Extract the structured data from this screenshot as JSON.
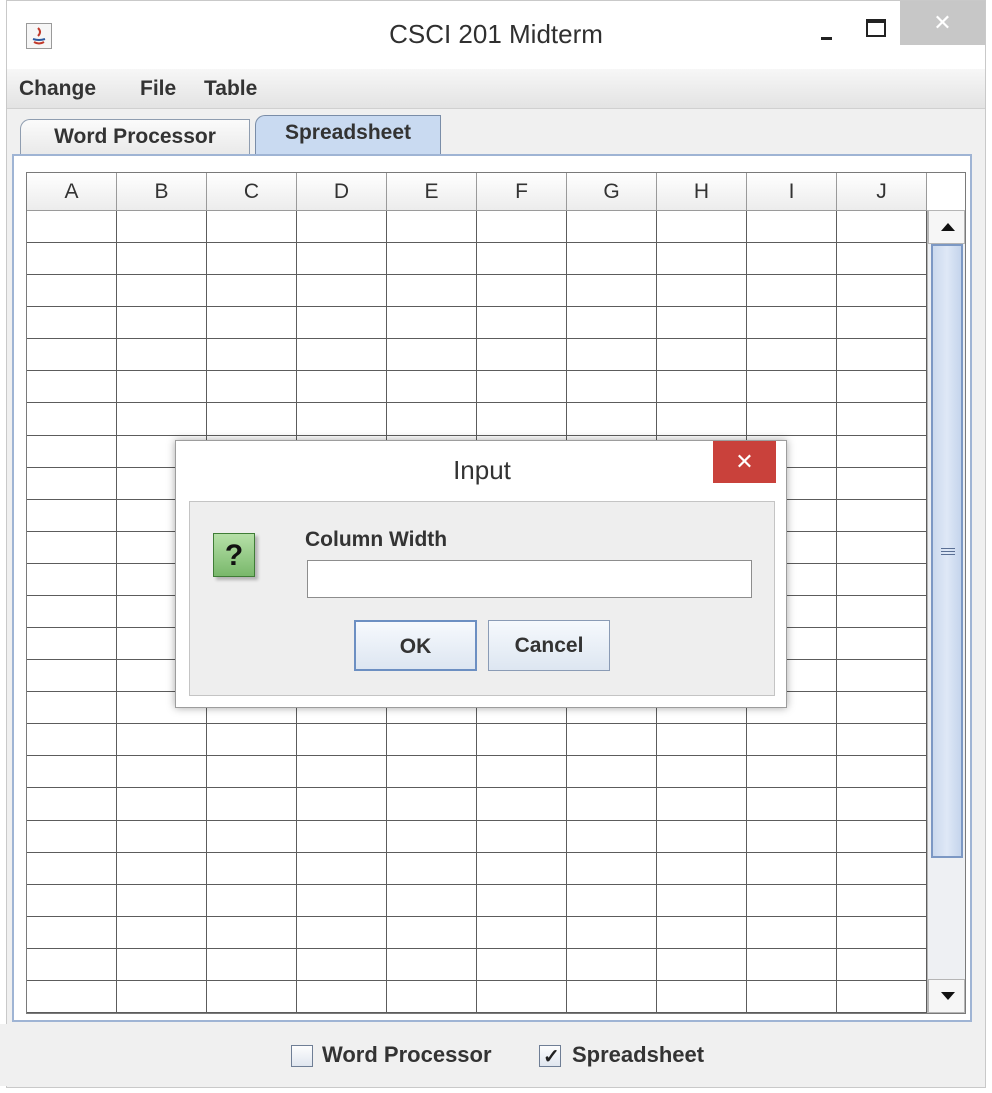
{
  "window": {
    "title": "CSCI 201 Midterm",
    "close_glyph": "✕"
  },
  "menu": {
    "items": [
      "Change",
      "File",
      "Table"
    ]
  },
  "tabs": [
    {
      "label": "Word Processor",
      "active": false
    },
    {
      "label": "Spreadsheet",
      "active": true
    }
  ],
  "table": {
    "columns": [
      "A",
      "B",
      "C",
      "D",
      "E",
      "F",
      "G",
      "H",
      "I",
      "J"
    ],
    "row_count": 25
  },
  "bottom_toggles": {
    "word_processor_label": "Word Processor",
    "word_processor_checked": false,
    "spreadsheet_label": "Spreadsheet",
    "spreadsheet_checked": true,
    "check_glyph": "✓"
  },
  "dialog": {
    "title": "Input",
    "close_glyph": "✕",
    "icon_glyph": "?",
    "prompt": "Column Width",
    "input_value": "",
    "ok_label": "OK",
    "cancel_label": "Cancel"
  },
  "colors": {
    "active_tab": "#c9daf1",
    "dialog_close": "#c9413b",
    "question_icon": "#79b86b"
  }
}
